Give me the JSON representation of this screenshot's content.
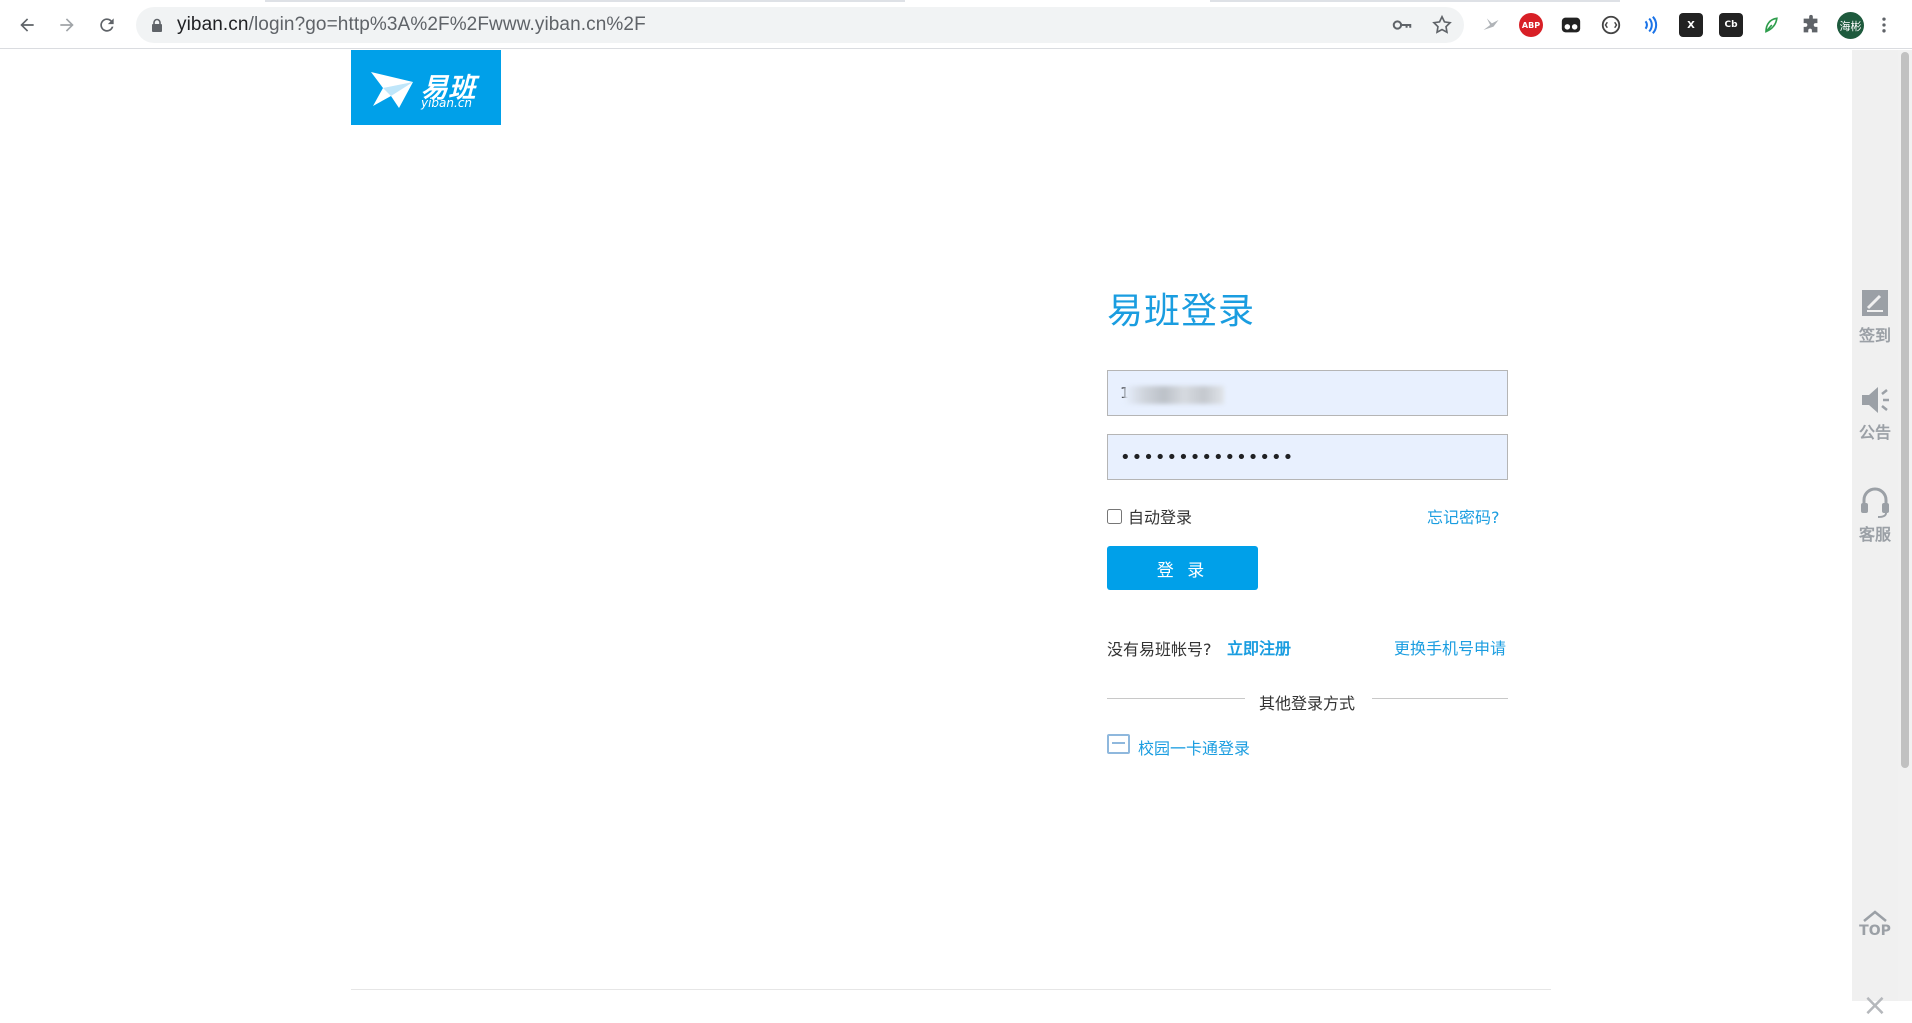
{
  "browser": {
    "url_host": "yiban.cn",
    "url_path": "/login?go=http%3A%2F%2Fwww.yiban.cn%2F",
    "avatar_label": "海彬",
    "ext_abp": "ABP",
    "ext_cb": "Cb",
    "ext_x": "X"
  },
  "logo": {
    "cn": "易班",
    "en": "yiban.cn"
  },
  "login": {
    "title": "易班登录",
    "username_value": "1",
    "password_value": "•••••••••••••••",
    "auto_login": "自动登录",
    "forgot": "忘记密码?",
    "submit": "登 录",
    "no_account": "没有易班帐号?",
    "register": "立即注册",
    "change_phone": "更换手机号申请",
    "other_methods": "其他登录方式",
    "campus_card": "校园一卡通登录"
  },
  "sidebar": {
    "checkin": "签到",
    "notice": "公告",
    "service": "客服",
    "top": "TOP",
    "close": "×"
  }
}
